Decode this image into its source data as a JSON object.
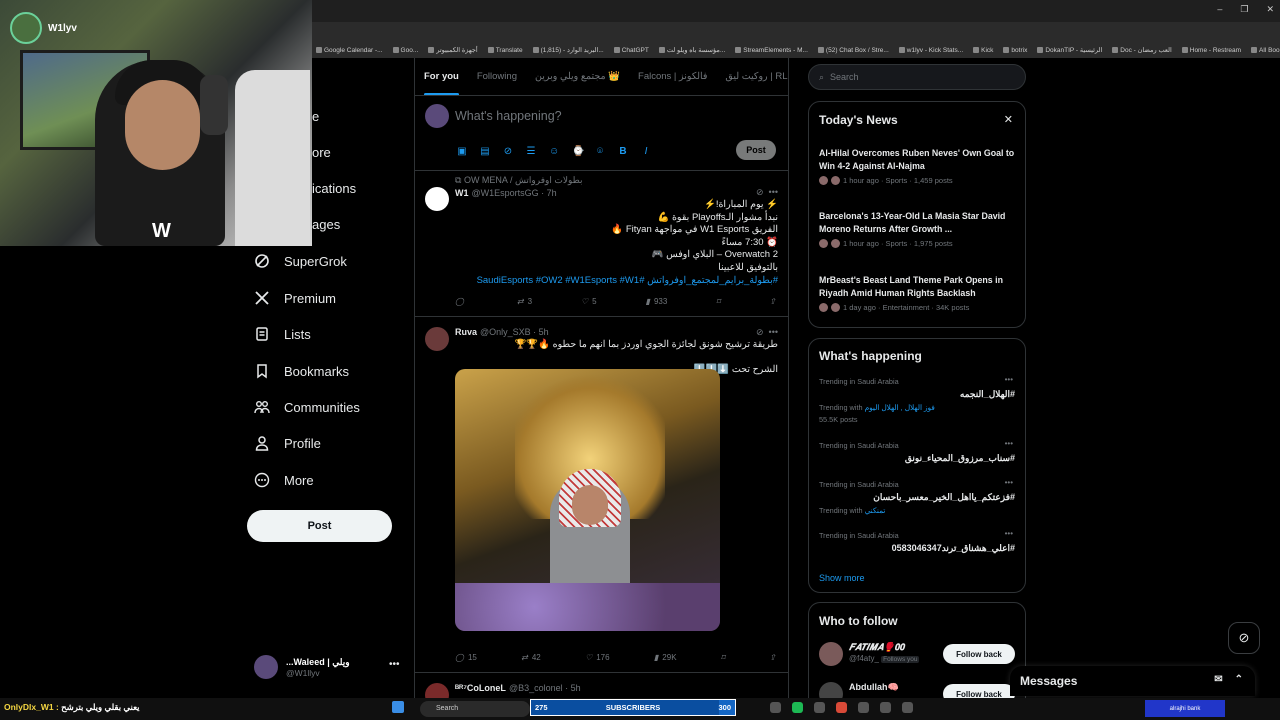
{
  "cam": {
    "username": "W1lyv"
  },
  "nav": {
    "items": [
      {
        "label": "SuperGrok",
        "icon": "supergrok-icon"
      },
      {
        "label": "Premium",
        "icon": "x-logo-icon"
      },
      {
        "label": "Lists",
        "icon": "list-icon"
      },
      {
        "label": "Bookmarks",
        "icon": "bookmark-icon"
      },
      {
        "label": "Communities",
        "icon": "communities-icon"
      },
      {
        "label": "Profile",
        "icon": "profile-icon"
      },
      {
        "label": "More",
        "icon": "more-circle-icon"
      }
    ],
    "partial": [
      "e",
      "ore",
      "ications",
      "ages"
    ],
    "post_label": "Post"
  },
  "account": {
    "name": "ويلي | Waleed...",
    "handle": "@W1llyv"
  },
  "bookmarks": [
    "Google Calendar -...",
    "Goo...",
    "أجهزة الكمبيوتر",
    "Translate",
    "البريد الوارد - (1,815)...",
    "ChatGPT",
    "مؤسسة باه ويلو لت...",
    "StreamElements - M...",
    "(52) Chat Box / Stre...",
    "w1lyv - Kick Stats...",
    "Kick",
    "botrix",
    "DokanTIP - الرئيسية",
    "Doc - العب رمضان",
    "Home - Restream",
    "All Bookmarks"
  ],
  "timeline": {
    "tabs": [
      "For you",
      "Following",
      "مجتمع ويلي وبرين 👑",
      "Falcons | فالكونز",
      "روكيت ليق | RL"
    ],
    "composer_placeholder": "What's happening?",
    "composer_post": "Post",
    "tweet1": {
      "context": "OW MENA / بطولات اوفرواتش",
      "name": "W1",
      "handle": "@W1EsportsGG · 7h",
      "lines": [
        "⚡ يوم المباراة!⚡",
        "نبدأ مشوار الـPlayoffs بقوة 💪",
        "الفريق W1 Esports في مواجهة Fityan 🔥",
        "⏰ 7:30 مساءً",
        "Overwatch 2 – البلاي اوفس 🎮",
        "بالتوفيق للاعبينا"
      ],
      "tags": "#بطولة_برايم_لمجتمع_اوفرواتش #SaudiEsports #OW2 #W1Esports #W1",
      "replies": "",
      "retweets": "3",
      "likes": "5",
      "views": "933"
    },
    "tweet2": {
      "name": "Ruva",
      "handle": "@Only_SXB · 5h",
      "line1": "طريقة ترشيح شونق لجائزة الجوي اوردز بما انهم ما حطوه 🔥🏆🏆",
      "line2": "الشرح تحت ⬇️⬇️⬇️",
      "replies": "15",
      "retweets": "42",
      "likes": "176",
      "views": "29K"
    },
    "tweet3": {
      "name": "ᴮᴿ⁷CoLoneL",
      "handle": "@B3_colonel · 5h"
    }
  },
  "right": {
    "search_placeholder": "Search",
    "news_title": "Today's News",
    "news": [
      {
        "title": "Al-Hilal Overcomes Ruben Neves' Own Goal to Win 4-2 Against Al-Najma",
        "meta": "1 hour ago · Sports · 1,459 posts"
      },
      {
        "title": "Barcelona's 13-Year-Old La Masia Star David Moreno Returns After Growth ...",
        "meta": "1 hour ago · Sports · 1,975 posts"
      },
      {
        "title": "MrBeast's Beast Land Theme Park Opens in Riyadh Amid Human Rights Backlash",
        "meta": "1 day ago · Entertainment · 34K posts"
      }
    ],
    "happening_title": "What's happening",
    "trends": [
      {
        "ctx": "Trending in Saudi Arabia",
        "name": "#الهلال_النجمه",
        "sub_prefix": "Trending with",
        "sub_links": "فوز الهلال , الهلال اليوم",
        "posts": "55.5K posts"
      },
      {
        "ctx": "Trending in Saudi Arabia",
        "name": "#سناب_مرزوق_المحياء_نونق",
        "sub_prefix": "",
        "sub_links": "",
        "posts": ""
      },
      {
        "ctx": "Trending in Saudi Arabia",
        "name": "#فزعتكم_يااهل_الخير_معسر_باحسان",
        "sub_prefix": "Trending with",
        "sub_links": "تمنكني",
        "posts": ""
      },
      {
        "ctx": "Trending in Saudi Arabia",
        "name": "#اعلي_هشناق_ترند0583046347",
        "sub_prefix": "",
        "sub_links": "",
        "posts": ""
      }
    ],
    "show_more": "Show more",
    "wtf_title": "Who to follow",
    "follow": [
      {
        "name": "𝑭𝑨𝑻𝑰𝑴𝑨🥊𝟎𝟎",
        "handle": "@f4aty_",
        "badge": "Follows you",
        "btn": "Follow back"
      },
      {
        "name": "Abdullah🧠",
        "handle": "",
        "badge": "",
        "btn": "Follow back"
      }
    ]
  },
  "messages": {
    "label": "Messages"
  },
  "taskbar": {
    "chat_user": "OnlyDlx_W1 :",
    "chat_msg": "يعني بقلي ويلي بترشح",
    "search": "Search",
    "sub_current": "275",
    "sub_label": "SUBSCRIBERS",
    "sub_goal": "300",
    "sub_progress": 0.92
  },
  "colors": {
    "accent": "#1d9bf0",
    "bg": "#000000",
    "border": "#2f3336",
    "muted": "#71767b"
  }
}
